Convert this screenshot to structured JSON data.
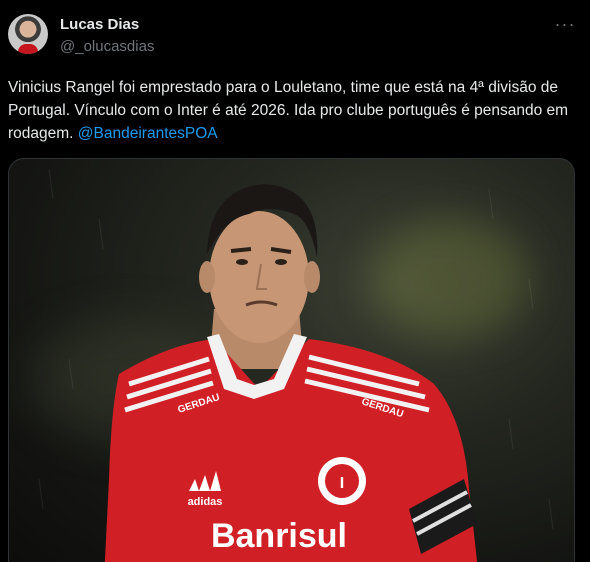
{
  "author": {
    "display_name": "Lucas Dias",
    "handle": "@_olucasdias",
    "avatar_icon": "profile-photo"
  },
  "more_icon": "more-horizontal-icon",
  "more_label": "···",
  "tweet": {
    "text": "Vinicius Rangel foi emprestado para o Louletano, time que está na 4ª divisão de Portugal. Vínculo com o Inter é até 2026. Ida pro clube português é pensando em rodagem. ",
    "mention": "@BandeirantesPOA"
  },
  "media": {
    "jersey_sponsor": "Banrisul",
    "jersey_brand": "adidas",
    "sleeve_sponsor": "GERDAU",
    "collar_sponsor": "GERDAU"
  },
  "colors": {
    "background": "#000000",
    "text": "#e7e9ea",
    "secondary_text": "#71767b",
    "link": "#1d9bf0",
    "jersey_red": "#d11f26"
  }
}
